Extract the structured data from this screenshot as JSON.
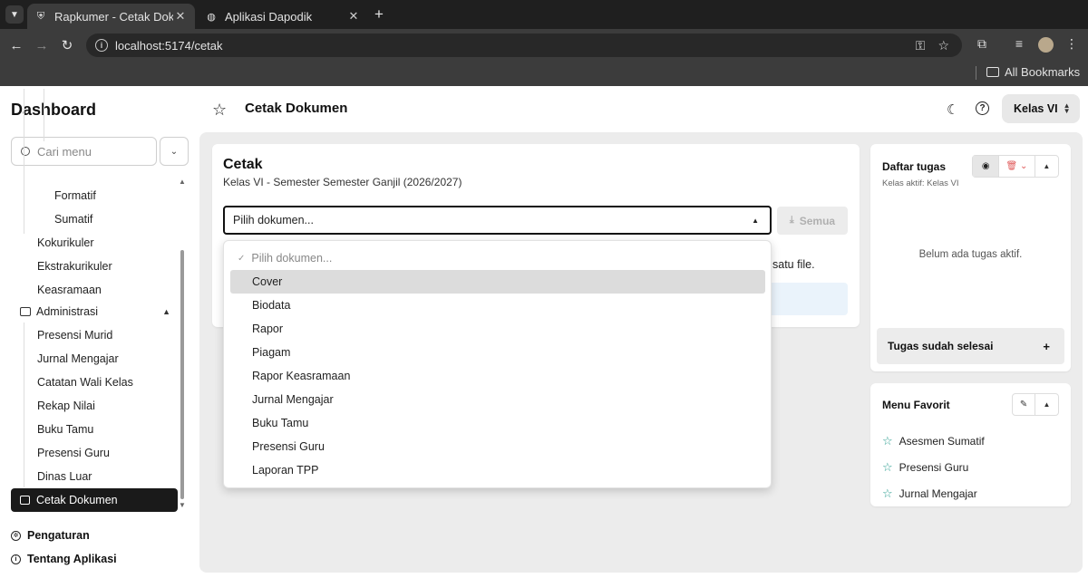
{
  "browser": {
    "tabs": [
      {
        "title": "Rapkumer - Cetak Doku",
        "active": true
      },
      {
        "title": "Aplikasi Dapodik",
        "active": false
      }
    ],
    "url": "localhost:5174/cetak",
    "bookmarks_label": "All Bookmarks"
  },
  "sidebar": {
    "title": "Dashboard",
    "search_placeholder": "Cari menu",
    "items": {
      "formatif": "Formatif",
      "sumatif": "Sumatif",
      "kokurikuler": "Kokurikuler",
      "ekstrakurikuler": "Ekstrakurikuler",
      "keasramaan": "Keasramaan"
    },
    "group_administrasi": "Administrasi",
    "admin_items": [
      "Presensi Murid",
      "Jurnal Mengajar",
      "Catatan Wali Kelas",
      "Rekap Nilai",
      "Buku Tamu",
      "Presensi Guru",
      "Dinas Luar"
    ],
    "active_item": "Cetak Dokumen",
    "footer": {
      "pengaturan": "Pengaturan",
      "tentang": "Tentang Aplikasi"
    }
  },
  "header": {
    "title": "Cetak Dokumen",
    "class_selector": "Kelas VI"
  },
  "cetak": {
    "title": "Cetak",
    "subtitle": "Kelas VI - Semester Semester Ganjil (2026/2027)",
    "select_value": "Pilih dokumen...",
    "semua_label": "Semua",
    "helper_partial": "satu file."
  },
  "dropdown": {
    "placeholder": "Pilih dokumen...",
    "options": [
      "Cover",
      "Biodata",
      "Rapor",
      "Piagam",
      "Rapor Keasramaan",
      "Jurnal Mengajar",
      "Buku Tamu",
      "Presensi Guru",
      "Laporan TPP"
    ],
    "highlighted": "Cover"
  },
  "tasks": {
    "title": "Daftar tugas",
    "subtitle": "Kelas aktif: Kelas VI",
    "empty": "Belum ada tugas aktif.",
    "done_label": "Tugas sudah selesai"
  },
  "favorites": {
    "title": "Menu Favorit",
    "items": [
      "Asesmen Sumatif",
      "Presensi Guru",
      "Jurnal Mengajar"
    ]
  },
  "colors": {
    "accent": "#1a1a1a",
    "favorite_star": "#2a9d8f",
    "delete": "#e05a5a"
  }
}
